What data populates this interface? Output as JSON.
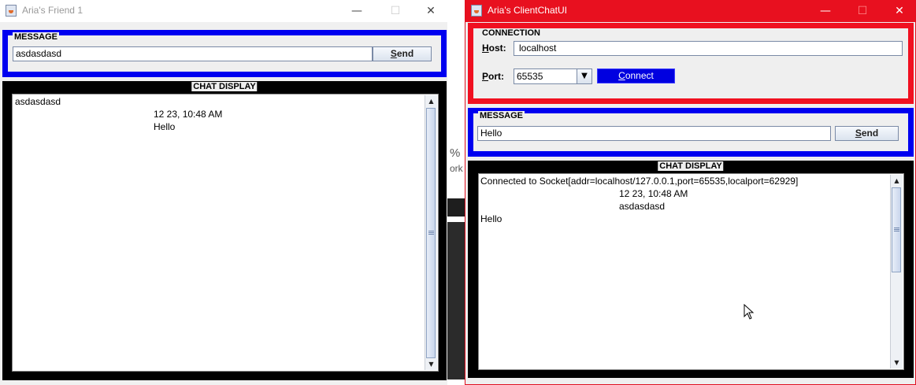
{
  "left_window": {
    "title": "Aria's Friend 1",
    "message_panel": {
      "legend": "MESSAGE",
      "input_value": "asdasdasd",
      "send_label": "Send",
      "send_mnemonic": "S",
      "send_rest": "end"
    },
    "chat_panel": {
      "legend": "CHAT DISPLAY",
      "lines": [
        "asdasdasd",
        "12 23, 10:48 AM",
        "Hello"
      ]
    }
  },
  "right_window": {
    "title": "Aria's ClientChatUI",
    "connection_panel": {
      "legend": "CONNECTION",
      "host_label_mnemonic": "H",
      "host_label_rest": "ost:",
      "host_value": "localhost",
      "port_label_mnemonic": "P",
      "port_label_rest": "ort:",
      "port_value": "65535",
      "connect_mnemonic": "C",
      "connect_rest": "onnect"
    },
    "message_panel": {
      "legend": "MESSAGE",
      "input_value": "Hello",
      "send_mnemonic": "S",
      "send_rest": "end"
    },
    "chat_panel": {
      "legend": "CHAT DISPLAY",
      "lines": [
        "Connected to Socket[addr=localhost/127.0.0.1,port=65535,localport=62929]",
        "12 23, 10:48 AM",
        "asdasdasd",
        "Hello"
      ]
    }
  },
  "background_fragments": [
    "%",
    "ork"
  ],
  "window_controls": {
    "minimize": "—",
    "maximize": "☐",
    "close": "✕"
  },
  "colors": {
    "left_title_bg": "#ffffff",
    "right_title_bg": "#e8101f",
    "message_border": "#0000f0",
    "connection_border": "#f01020",
    "chat_border": "#000000",
    "connect_button": "#0000e0"
  }
}
